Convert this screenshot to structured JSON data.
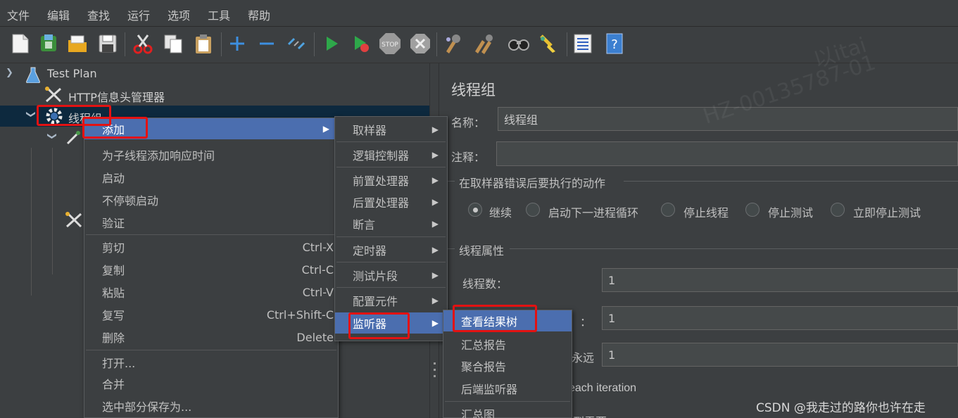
{
  "menubar": {
    "items": [
      "文件",
      "编辑",
      "查找",
      "运行",
      "选项",
      "工具",
      "帮助"
    ]
  },
  "toolbar": {
    "icons": [
      "new-icon",
      "templates-icon",
      "open-icon",
      "save-icon",
      "cut-icon",
      "copy-icon",
      "paste-icon",
      "expand-icon",
      "collapse-icon",
      "toggle-icon",
      "start-icon",
      "start-no-pause-icon",
      "stop-icon",
      "shutdown-icon",
      "clear-icon",
      "clear-all-icon",
      "search-icon",
      "reset-search-icon",
      "function-helper-icon",
      "help-icon"
    ]
  },
  "tree": {
    "test_plan": "Test Plan",
    "header_manager": "HTTP信息头管理器",
    "thread_group": "线程组"
  },
  "context_menu": {
    "add": "添加",
    "add_response_time": "为子线程添加响应时间",
    "start": "启动",
    "start_no_pause": "不停顿启动",
    "validate": "验证",
    "cut": "剪切",
    "cut_sc": "Ctrl-X",
    "copy": "复制",
    "copy_sc": "Ctrl-C",
    "paste": "粘贴",
    "paste_sc": "Ctrl-V",
    "duplicate": "复写",
    "duplicate_sc": "Ctrl+Shift-C",
    "remove": "删除",
    "remove_sc": "Delete",
    "open": "打开...",
    "merge": "合并",
    "save_selection": "选中部分保存为..."
  },
  "add_submenu": {
    "sampler": "取样器",
    "logic_controller": "逻辑控制器",
    "pre_processor": "前置处理器",
    "post_processor": "后置处理器",
    "assertion": "断言",
    "timer": "定时器",
    "test_fragment": "测试片段",
    "config_element": "配置元件",
    "listener": "监听器"
  },
  "listener_submenu": {
    "view_results_tree": "查看结果树",
    "summary_report": "汇总报告",
    "aggregate_report": "聚合报告",
    "backend_listener": "后端监听器",
    "summary_graph": "汇总图"
  },
  "panel": {
    "title": "线程组",
    "name_label": "名称：",
    "name_value": "线程组",
    "comment_label": "注释：",
    "comment_value": "",
    "error_action_title": "在取样器错误后要执行的动作",
    "actions": [
      "继续",
      "启动下一进程循环",
      "停止线程",
      "停止测试",
      "立即停止测试"
    ],
    "selected_action": 0,
    "thread_props_title": "线程属性",
    "threads_label": "线程数：",
    "threads_value": "1",
    "ramp_label_fragment": "：",
    "ramp_value": "1",
    "loop_label_fragment": "永远",
    "loop_value": "1",
    "same_user_fragment": "each iteration",
    "delay_fragment": "到需要"
  },
  "watermark": {
    "line1": "HZ-00135787-01",
    "line2": "以itai",
    "csdn": "CSDN @我走过的路你也许在走"
  }
}
